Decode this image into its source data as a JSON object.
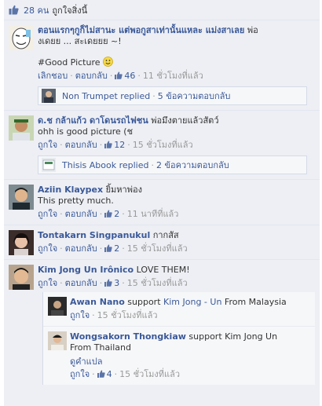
{
  "likes_bar": {
    "count": "28 คน",
    "text": "ถูกใจสิ่งนี้"
  },
  "comments": [
    {
      "author": "ตอนแรกๆกูก็ไม่สานะ แต่พอกูสาเท่านั้นแหละ แม่งสาเลย",
      "text_inline": "พ่อ",
      "text_line2": "งเดยย ... สะเดยยย ~!",
      "text_line3": "#Good Picture",
      "actions": {
        "hide": "เลิกชอบ",
        "reply": "ตอบกลับ",
        "likes": "46",
        "time": "11 ชั่วโมงที่แล้ว"
      },
      "reply": {
        "name": "Non Trumpet replied",
        "count": "5 ข้อความตอบกลับ"
      }
    },
    {
      "author": "ด.ช กล้าแก้ว ดาโดนรถไฟชน",
      "text_inline": "พ่อมึงตายแล้วสัตว์",
      "text_line2": "ohh is good picture (ช",
      "actions": {
        "like": "ถูกใจ",
        "reply": "ตอบกลับ",
        "likes": "12",
        "time": "15 ชั่วโมงที่แล้ว"
      },
      "reply": {
        "name": "Thisis Abook replied",
        "count": "2 ข้อความตอบกลับ"
      }
    },
    {
      "author": "Aziin Klaypex",
      "text_inline": "ยิ้มหาพ่อง",
      "text_line2": "This pretty much.",
      "actions": {
        "like": "ถูกใจ",
        "reply": "ตอบกลับ",
        "likes": "2",
        "time": "11 นาทีที่แล้ว"
      }
    },
    {
      "author": "Tontakarn Singpanukul",
      "text_inline": "กากสัส",
      "actions": {
        "like": "ถูกใจ",
        "reply": "ตอบกลับ",
        "likes": "2",
        "time": "15 ชั่วโมงที่แล้ว"
      }
    },
    {
      "author": "Kim Jong Un Irônico",
      "text_inline": "LOVE THEM!",
      "actions": {
        "like": "ถูกใจ",
        "reply": "ตอบกลับ",
        "likes": "3",
        "time": "15 ชั่วโมงที่แล้ว"
      },
      "subs": [
        {
          "author": "Awan Nano",
          "text_pre": "support",
          "mention": "Kim Jong - Un",
          "text_post": "From Malaysia",
          "actions": {
            "like": "ถูกใจ",
            "time": "15 ชั่วโมงที่แล้ว"
          }
        },
        {
          "author": "Wongsakorn Thongkiaw",
          "text_pre": "support Kim Jong Un",
          "text_line2": "From Thailand",
          "translate": "ดูคำแปล",
          "actions": {
            "like": "ถูกใจ",
            "likes": "4",
            "time": "15 ชั่วโมงที่แล้ว"
          }
        }
      ]
    }
  ]
}
